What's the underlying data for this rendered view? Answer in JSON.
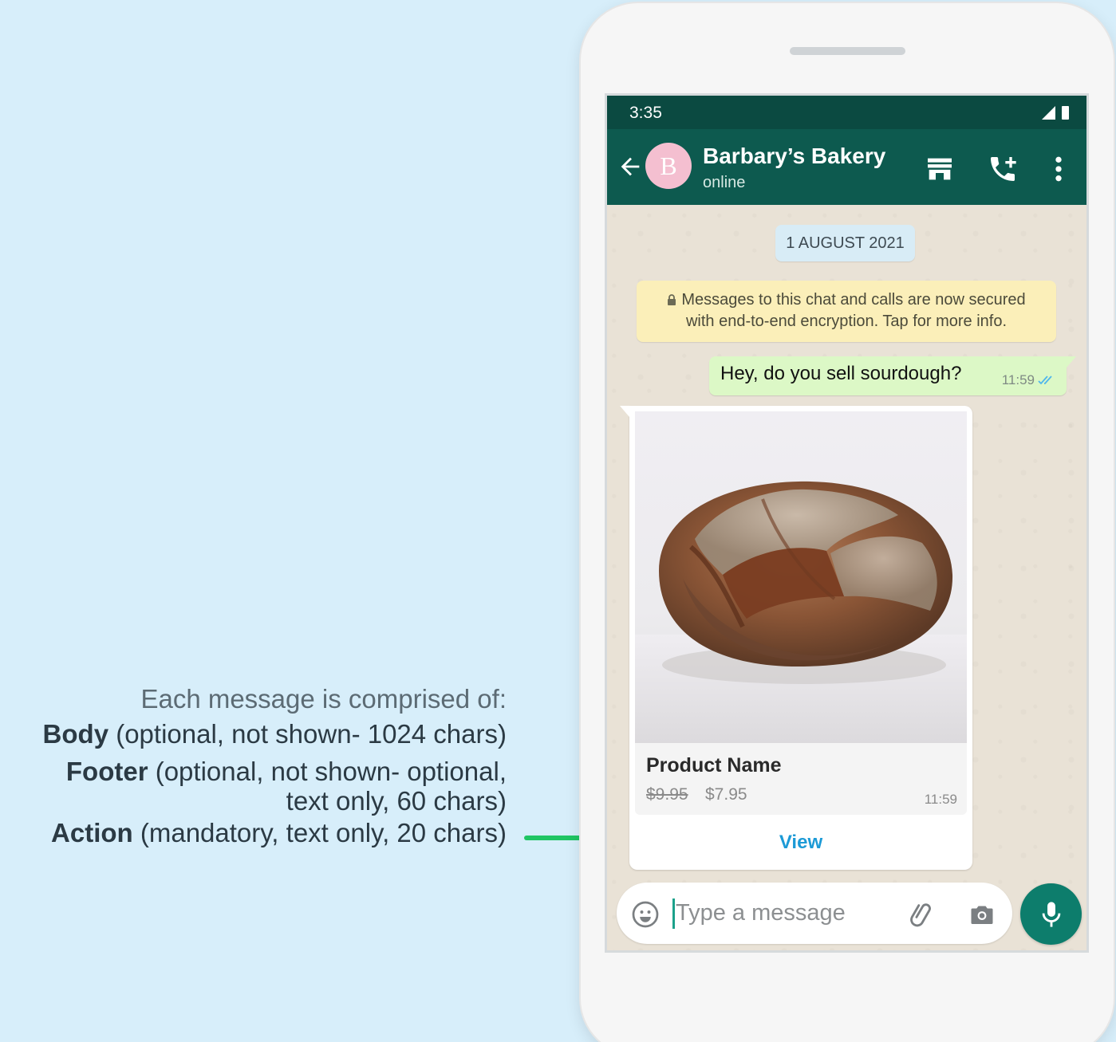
{
  "annotation": {
    "intro": "Each message is comprised of:",
    "body_label": "Body",
    "body_desc": " (optional, not shown- 1024 chars)",
    "footer_label": "Footer",
    "footer_desc_line1": " (optional, not shown- optional,",
    "footer_desc_line2": "text only, 60 chars)",
    "action_label": "Action",
    "action_desc": " (mandatory, text only, 20 chars)",
    "connector_color": "#1fc563"
  },
  "status_bar": {
    "time": "3:35"
  },
  "app_bar": {
    "avatar_letter": "B",
    "contact_name": "Barbary’s Bakery",
    "contact_status": "online",
    "icons": [
      "back-arrow-icon",
      "store-icon",
      "add-call-icon",
      "more-vert-icon"
    ]
  },
  "chat": {
    "date_chip": "1 AUGUST 2021",
    "encryption_notice_line1": "Messages to this chat and calls are now secured",
    "encryption_notice_line2": "with end-to-end encryption. Tap for more info.",
    "outgoing_message": {
      "text": "Hey, do you sell sourdough?",
      "time": "11:59",
      "status": "read"
    },
    "product_card": {
      "image": "sourdough-loaf",
      "name": "Product Name",
      "old_price": "$9.95",
      "new_price": "$7.95",
      "time": "11:59",
      "action_label": "View"
    }
  },
  "input_bar": {
    "placeholder": "Type a message",
    "value": "",
    "icons": [
      "emoji-icon",
      "attach-icon",
      "camera-icon",
      "mic-icon"
    ]
  },
  "colors": {
    "page_background": "#d7eefa",
    "app_bar": "#0d5a4f",
    "status_bar": "#0b4a41",
    "outgoing_bubble": "#dcf8c6",
    "date_chip": "#d8ecf6",
    "encryption_chip": "#fbefb9",
    "action_link": "#1c9ad6",
    "mic_button": "#0d7d6c"
  }
}
